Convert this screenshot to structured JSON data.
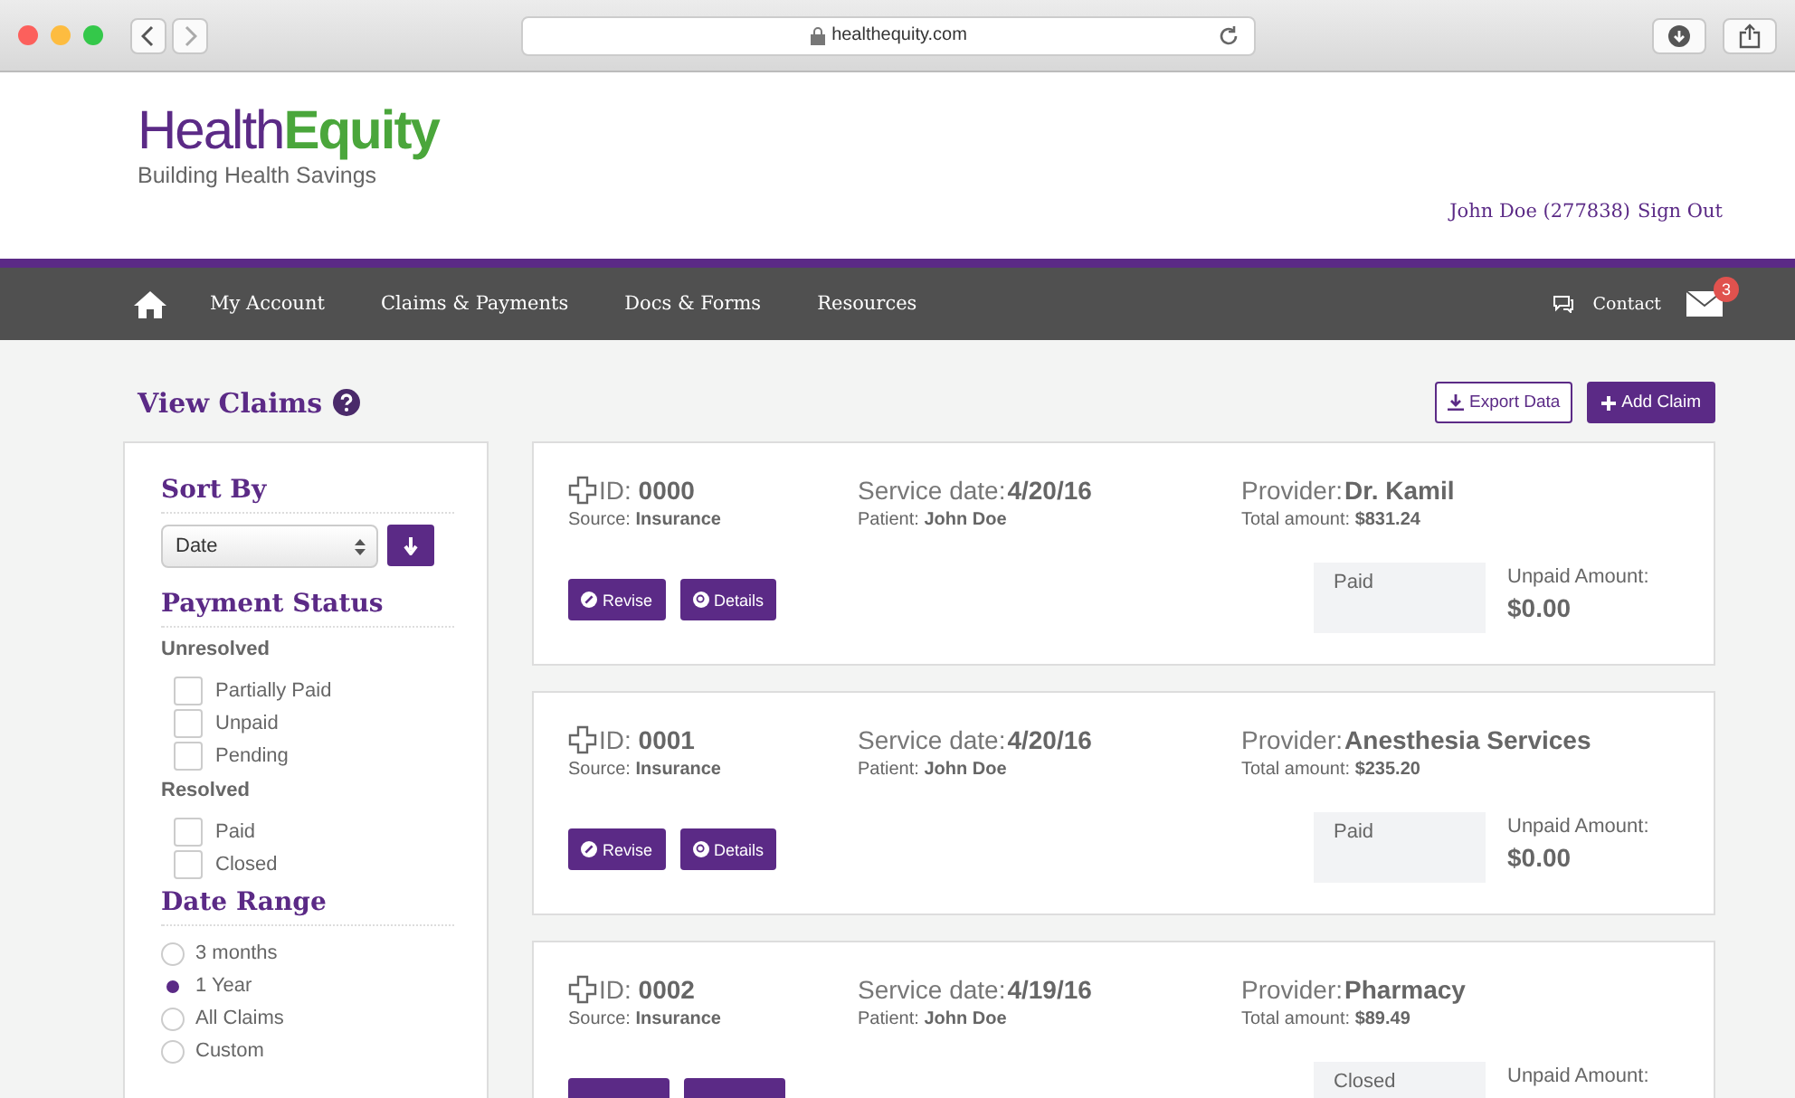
{
  "browser": {
    "url": "healthequity.com"
  },
  "header": {
    "logo_part1": "Health",
    "logo_part2": "Equity",
    "logo_tagline": "Building Health Savings",
    "user": "John Doe (277838)",
    "sign_out": "Sign Out"
  },
  "nav": {
    "items": [
      "My Account",
      "Claims & Payments",
      "Docs & Forms",
      "Resources"
    ],
    "contact": "Contact",
    "mail_count": "3"
  },
  "page": {
    "title": "View Claims",
    "export_button": "Export Data",
    "add_button": "Add Claim"
  },
  "sidebar": {
    "sort_heading": "Sort By",
    "sort_value": "Date",
    "status_heading": "Payment Status",
    "status_groups": [
      {
        "label": "Unresolved",
        "options": [
          {
            "label": "Partially Paid",
            "checked": false
          },
          {
            "label": "Unpaid",
            "checked": false
          },
          {
            "label": "Pending",
            "checked": false
          }
        ]
      },
      {
        "label": "Resolved",
        "options": [
          {
            "label": "Paid",
            "checked": false
          },
          {
            "label": "Closed",
            "checked": false
          }
        ]
      }
    ],
    "range_heading": "Date Range",
    "ranges": [
      {
        "label": "3 months",
        "selected": false
      },
      {
        "label": "1 Year",
        "selected": true
      },
      {
        "label": "All Claims",
        "selected": false
      },
      {
        "label": "Custom",
        "selected": false
      }
    ]
  },
  "claims": [
    {
      "id_label": "ID:",
      "id": "0000",
      "source_label": "Source:",
      "source": "Insurance",
      "date_label": "Service date:",
      "date": "4/20/16",
      "patient_label": "Patient:",
      "patient": "John Doe",
      "provider_label": "Provider:",
      "provider": "Dr. Kamil",
      "total_label": "Total amount:",
      "total": "$831.24",
      "buttons": [
        "Revise",
        "Details"
      ],
      "status": "Paid",
      "unpaid_label": "Unpaid Amount:",
      "unpaid": "$0.00"
    },
    {
      "id_label": "ID:",
      "id": "0001",
      "source_label": "Source:",
      "source": "Insurance",
      "date_label": "Service date:",
      "date": "4/20/16",
      "patient_label": "Patient:",
      "patient": "John Doe",
      "provider_label": "Provider:",
      "provider": "Anesthesia Services",
      "total_label": "Total amount:",
      "total": "$235.20",
      "buttons": [
        "Revise",
        "Details"
      ],
      "status": "Paid",
      "unpaid_label": "Unpaid Amount:",
      "unpaid": "$0.00"
    },
    {
      "id_label": "ID:",
      "id": "0002",
      "source_label": "Source:",
      "source": "Insurance",
      "date_label": "Service date:",
      "date": "4/19/16",
      "patient_label": "Patient:",
      "patient": "John Doe",
      "provider_label": "Provider:",
      "provider": "Pharmacy",
      "total_label": "Total amount:",
      "total": "$89.49",
      "status": "Closed",
      "unpaid_label": "Unpaid Amount:"
    }
  ]
}
